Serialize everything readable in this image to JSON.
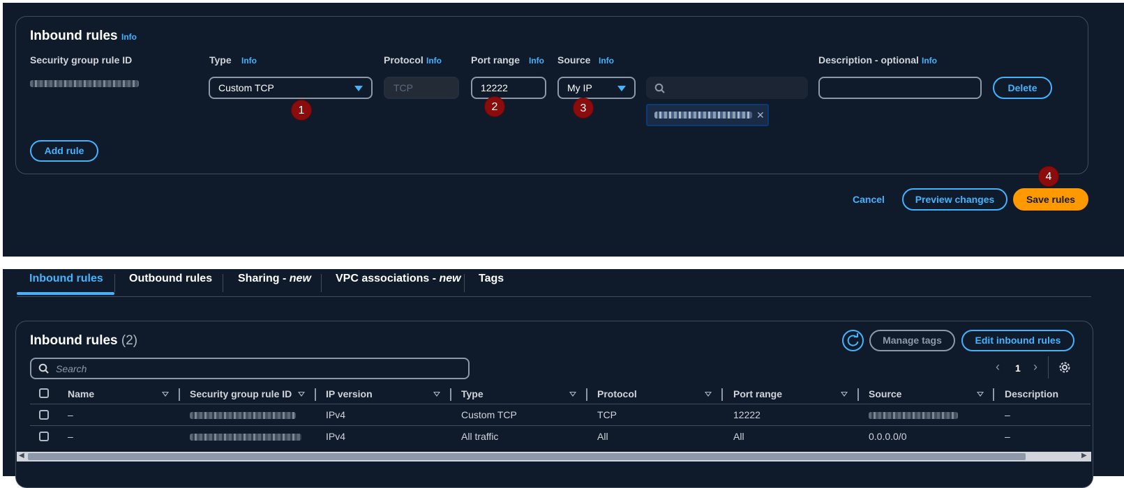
{
  "edit_form": {
    "title": "Inbound rules",
    "title_info": "Info",
    "columns": {
      "rule_id": "Security group rule ID",
      "type": "Type",
      "type_info": "Info",
      "protocol": "Protocol",
      "protocol_info": "Info",
      "port_range": "Port range",
      "port_range_info": "Info",
      "source": "Source",
      "source_info": "Info",
      "description": "Description - optional",
      "description_info": "Info"
    },
    "rule": {
      "type_value": "Custom TCP",
      "protocol_value": "TCP",
      "port_value": "12222",
      "source_value": "My IP",
      "source_search_value": "",
      "description_value": "",
      "delete_label": "Delete"
    },
    "add_rule_label": "Add rule",
    "badges": [
      "1",
      "2",
      "3",
      "4"
    ]
  },
  "footer": {
    "cancel_label": "Cancel",
    "preview_label": "Preview changes",
    "save_label": "Save rules"
  },
  "tabs": [
    {
      "label": "Inbound rules",
      "suffix": ""
    },
    {
      "label": "Outbound rules",
      "suffix": ""
    },
    {
      "label": "Sharing - ",
      "suffix": "new"
    },
    {
      "label": "VPC associations - ",
      "suffix": "new"
    },
    {
      "label": "Tags",
      "suffix": ""
    }
  ],
  "rules_table": {
    "title": "Inbound rules",
    "count": "(2)",
    "manage_tags_label": "Manage tags",
    "edit_label": "Edit inbound rules",
    "search_placeholder": "Search",
    "page": "1",
    "headers": [
      "Name",
      "Security group rule ID",
      "IP version",
      "Type",
      "Protocol",
      "Port range",
      "Source",
      "Description"
    ],
    "rows": [
      {
        "name": "–",
        "ip_version": "IPv4",
        "type": "Custom TCP",
        "protocol": "TCP",
        "port_range": "12222",
        "source": "",
        "description": "–"
      },
      {
        "name": "–",
        "ip_version": "IPv4",
        "type": "All traffic",
        "protocol": "All",
        "port_range": "All",
        "source": "0.0.0.0/0",
        "description": "–"
      }
    ]
  },
  "colors": {
    "background": "#0f1b2a",
    "accent": "#42b4ff",
    "primary_button": "#ff9900",
    "badge": "#8b0c0c"
  }
}
